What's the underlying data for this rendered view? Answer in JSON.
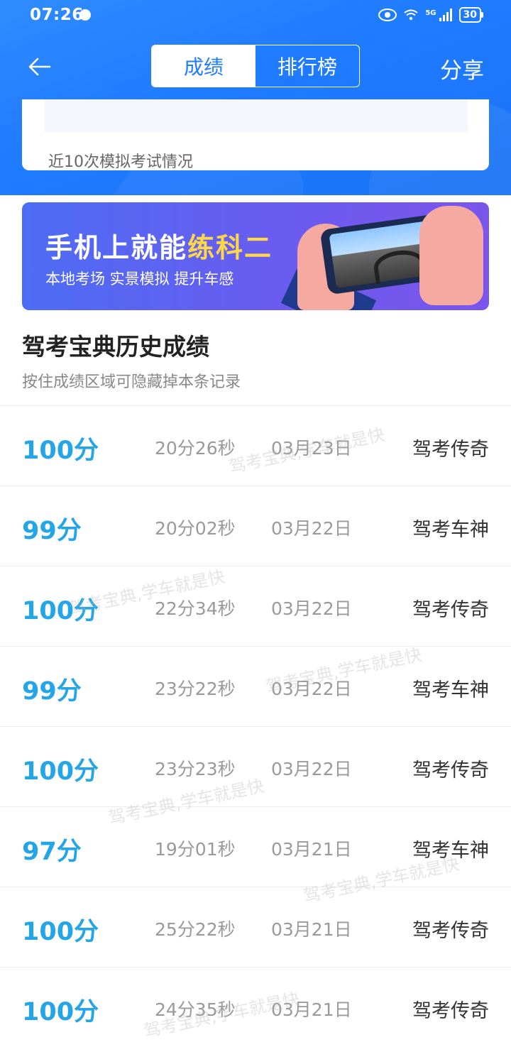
{
  "status_bar": {
    "time": "07:26",
    "network": "5G",
    "battery": "30"
  },
  "header": {
    "tabs": [
      {
        "label": "成绩",
        "active": true
      },
      {
        "label": "排行榜",
        "active": false
      }
    ],
    "share_label": "分享"
  },
  "chart_card": {
    "caption": "近10次模拟考试情况"
  },
  "banner": {
    "title_plain": "手机上就能",
    "title_highlight": "练科二",
    "subtitle": "本地考场 实景模拟 提升车感"
  },
  "history": {
    "title": "驾考宝典历史成绩",
    "hint": "按住成绩区域可隐藏掉本条记录",
    "records": [
      {
        "score": "100分",
        "duration": "20分26秒",
        "date": "03月23日",
        "level": "驾考传奇"
      },
      {
        "score": "99分",
        "duration": "20分02秒",
        "date": "03月22日",
        "level": "驾考车神"
      },
      {
        "score": "100分",
        "duration": "22分34秒",
        "date": "03月22日",
        "level": "驾考传奇"
      },
      {
        "score": "99分",
        "duration": "23分22秒",
        "date": "03月22日",
        "level": "驾考车神"
      },
      {
        "score": "100分",
        "duration": "23分23秒",
        "date": "03月22日",
        "level": "驾考传奇"
      },
      {
        "score": "97分",
        "duration": "19分01秒",
        "date": "03月21日",
        "level": "驾考车神"
      },
      {
        "score": "100分",
        "duration": "25分22秒",
        "date": "03月21日",
        "level": "驾考传奇"
      },
      {
        "score": "100分",
        "duration": "24分35秒",
        "date": "03月21日",
        "level": "驾考传奇"
      }
    ]
  },
  "watermark": "驾考宝典,学车就是快",
  "colors": {
    "header_blue": "#1f7bff",
    "score_blue": "#23a5e8"
  }
}
